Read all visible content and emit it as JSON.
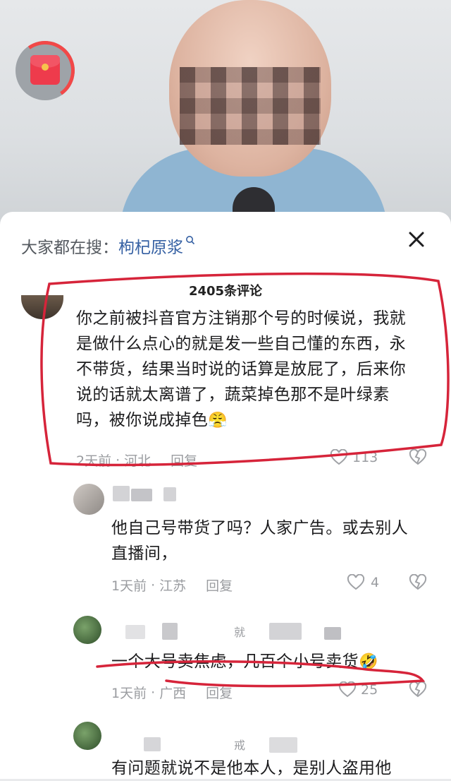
{
  "video": {
    "red_packet_icon": "red-envelope-icon",
    "accent_color": "#ee3b4c"
  },
  "search": {
    "label": "大家都在搜：",
    "keyword": "枸杞原浆",
    "search_icon": "search-icon"
  },
  "sheet": {
    "close_icon": "close-icon",
    "comment_count": "2405条评论"
  },
  "comments": [
    {
      "text": "你之前被抖音官方注销那个号的时候说，我就是做什么点心的就是发一些自己懂的东西，永不带货，结果当时说的话算是放屁了，后来你说的话就太离谱了，蔬菜掉色那不是叶绿素吗，被你说成掉色",
      "emoji": "😤",
      "time": "2天前",
      "location": "河北",
      "reply": "回复",
      "likes": "113"
    },
    {
      "text": "他自己号带货了吗？人家广告。或去别人直播间，",
      "time": "1天前",
      "location": "江苏",
      "reply": "回复",
      "likes": "4"
    },
    {
      "name_fragment": "就",
      "text": "一个大号卖焦虑，几百个小号卖货",
      "emoji": "🤣",
      "time": "1天前",
      "location": "广西",
      "reply": "回复",
      "likes": "25"
    },
    {
      "name_fragment": "戒",
      "text": "有问题就说不是他本人，是别人盗用他"
    }
  ],
  "annotation_color": "#d6243a"
}
